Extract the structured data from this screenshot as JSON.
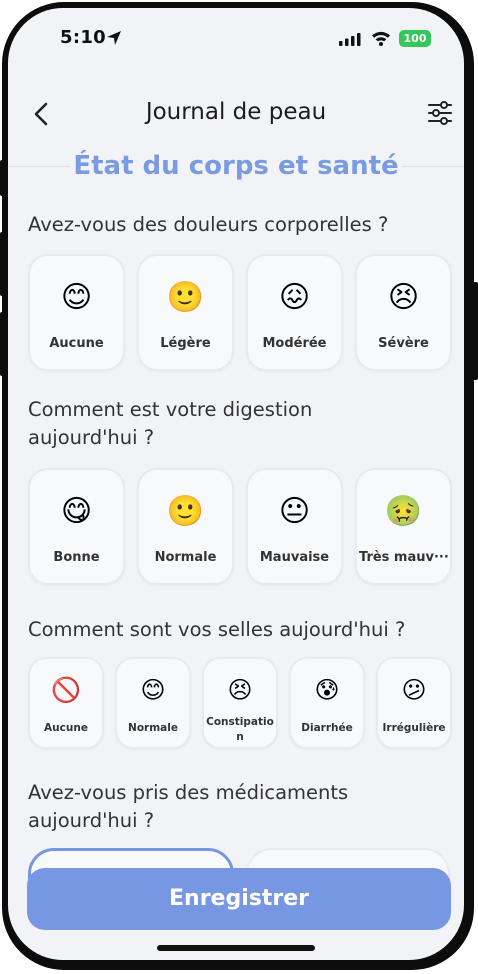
{
  "status_bar": {
    "time": "5:10",
    "battery": "100"
  },
  "nav": {
    "title": "Journal de peau",
    "back_icon": "chevron-left-icon",
    "filter_icon": "sliders-icon"
  },
  "section": {
    "title": "État du corps et santé"
  },
  "questions": [
    {
      "text": "Avez-vous des douleurs corporelles ?",
      "options": [
        {
          "emoji": "😊",
          "label": "Aucune"
        },
        {
          "emoji": "🙂",
          "label": "Légère"
        },
        {
          "emoji": "😖",
          "label": "Modérée"
        },
        {
          "emoji": "😣",
          "label": "Sévère"
        }
      ]
    },
    {
      "text": "Comment est votre digestion aujourd'hui ?",
      "options": [
        {
          "emoji": "😋",
          "label": "Bonne"
        },
        {
          "emoji": "🙂",
          "label": "Normale"
        },
        {
          "emoji": "😐",
          "label": "Mauvaise"
        },
        {
          "emoji": "🤢",
          "label": "Très mauv···"
        }
      ]
    },
    {
      "text": "Comment sont vos selles aujourd'hui ?",
      "options": [
        {
          "emoji": "🚫",
          "label": "Aucune"
        },
        {
          "emoji": "😊",
          "label": "Normale"
        },
        {
          "emoji": "😣",
          "label": "Constipation"
        },
        {
          "emoji": "😰",
          "label": "Diarrhée"
        },
        {
          "emoji": "😕",
          "label": "Irrégulière"
        }
      ]
    },
    {
      "text": "Avez-vous pris des médicaments aujourd'hui ?"
    }
  ],
  "save_button": {
    "label": "Enregistrer"
  },
  "colors": {
    "accent": "#7797e3",
    "section_title": "#7a9be0",
    "background": "#f2f3f7",
    "battery": "#34c759"
  }
}
